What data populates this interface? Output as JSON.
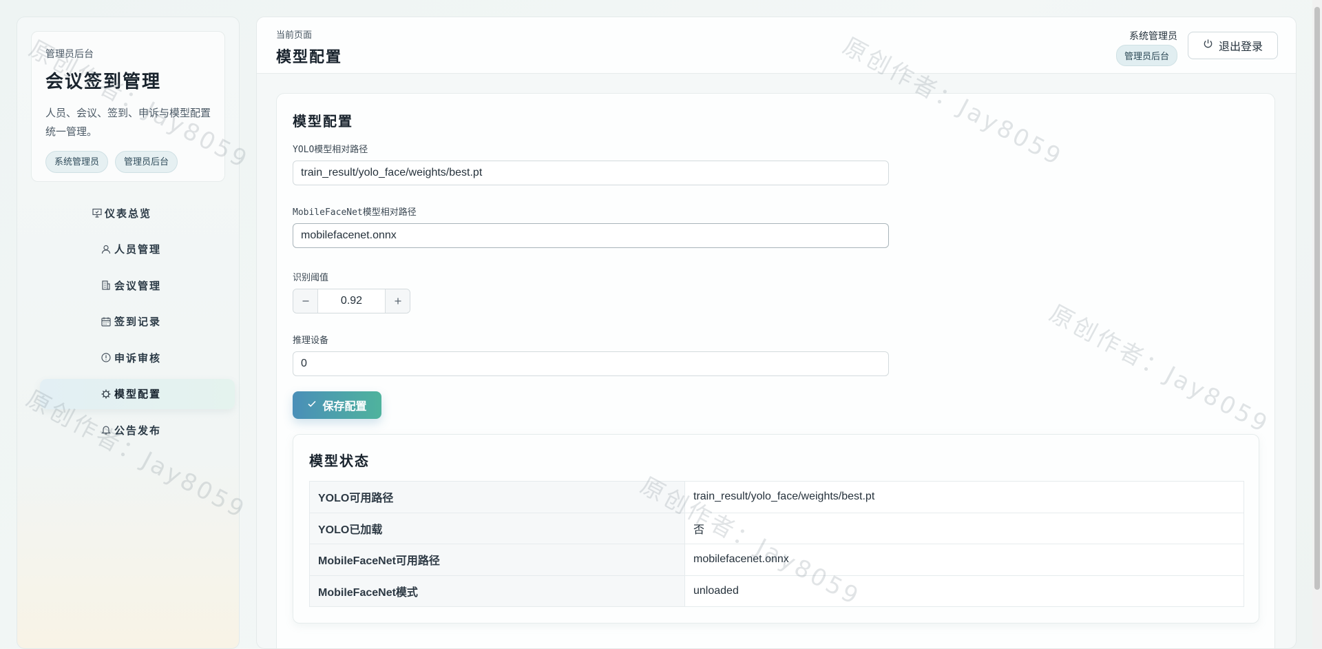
{
  "sidebar": {
    "brand": {
      "kicker": "管理员后台",
      "title": "会议签到管理",
      "description": "人员、会议、签到、申诉与模型配置统一管理。",
      "tags": [
        "系统管理员",
        "管理员后台"
      ]
    },
    "nav": [
      {
        "label": "仪表总览",
        "icon": "presentation-board-icon"
      },
      {
        "label": "人员管理",
        "icon": "user-icon"
      },
      {
        "label": "会议管理",
        "icon": "building-icon"
      },
      {
        "label": "签到记录",
        "icon": "calendar-icon"
      },
      {
        "label": "申诉审核",
        "icon": "alert-circle-icon"
      },
      {
        "label": "模型配置",
        "icon": "chip-icon",
        "active": true
      },
      {
        "label": "公告发布",
        "icon": "bell-icon"
      }
    ]
  },
  "header": {
    "breadcrumb": "当前页面",
    "title": "模型配置",
    "user_name": "系统管理员",
    "user_role": "管理员后台",
    "logout_label": "退出登录"
  },
  "form": {
    "title": "模型配置",
    "yolo_label": "YOLO模型相对路径",
    "yolo_value": "train_result/yolo_face/weights/best.pt",
    "mobileface_label": "MobileFaceNet模型相对路径",
    "mobileface_value": "mobilefacenet.onnx",
    "threshold_label": "识别阈值",
    "threshold_value": "0.92",
    "device_label": "推理设备",
    "device_value": "0",
    "save_label": "保存配置"
  },
  "status": {
    "title": "模型状态",
    "rows": [
      {
        "key": "YOLO可用路径",
        "value": "train_result/yolo_face/weights/best.pt"
      },
      {
        "key": "YOLO已加载",
        "value": "否"
      },
      {
        "key": "MobileFaceNet可用路径",
        "value": "mobilefacenet.onnx"
      },
      {
        "key": "MobileFaceNet模式",
        "value": "unloaded"
      }
    ]
  },
  "watermark": "原创作者：Jay8059",
  "colors": {
    "accent_start": "#4a8fb8",
    "accent_end": "#4fb39d"
  }
}
